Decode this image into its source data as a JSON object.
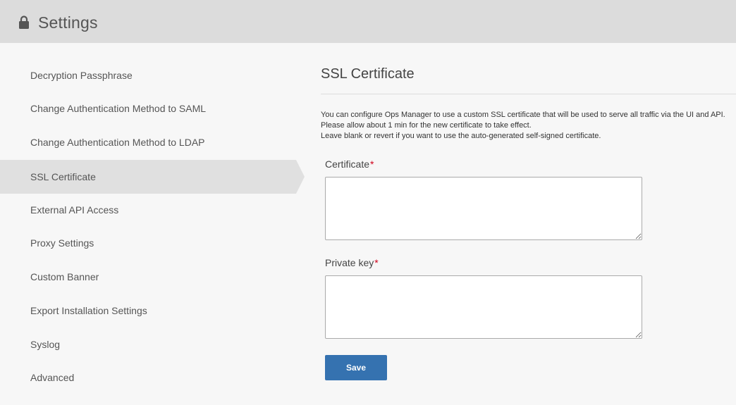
{
  "header": {
    "title": "Settings",
    "icon": "lock-icon"
  },
  "sidebar": {
    "items": [
      {
        "label": "Decryption Passphrase"
      },
      {
        "label": "Change Authentication Method to SAML"
      },
      {
        "label": "Change Authentication Method to LDAP"
      },
      {
        "label": "SSL Certificate",
        "active": true
      },
      {
        "label": "External API Access"
      },
      {
        "label": "Proxy Settings"
      },
      {
        "label": "Custom Banner"
      },
      {
        "label": "Export Installation Settings"
      },
      {
        "label": "Syslog"
      },
      {
        "label": "Advanced"
      }
    ]
  },
  "main": {
    "title": "SSL Certificate",
    "description": [
      "You can configure Ops Manager to use a custom SSL certificate that will be used to serve all traffic via the UI and API.",
      "Please allow about 1 min for the new certificate to take effect.",
      "Leave blank or revert if you want to use the auto-generated self-signed certificate."
    ],
    "certificate": {
      "label": "Certificate",
      "required_mark": "*",
      "value": ""
    },
    "private_key": {
      "label": "Private key",
      "required_mark": "*",
      "value": ""
    },
    "save_label": "Save"
  },
  "colors": {
    "header_bg": "#dcdcdc",
    "active_item_bg": "#e0e0e0",
    "button_bg": "#3572b0",
    "required": "#d0021b"
  }
}
